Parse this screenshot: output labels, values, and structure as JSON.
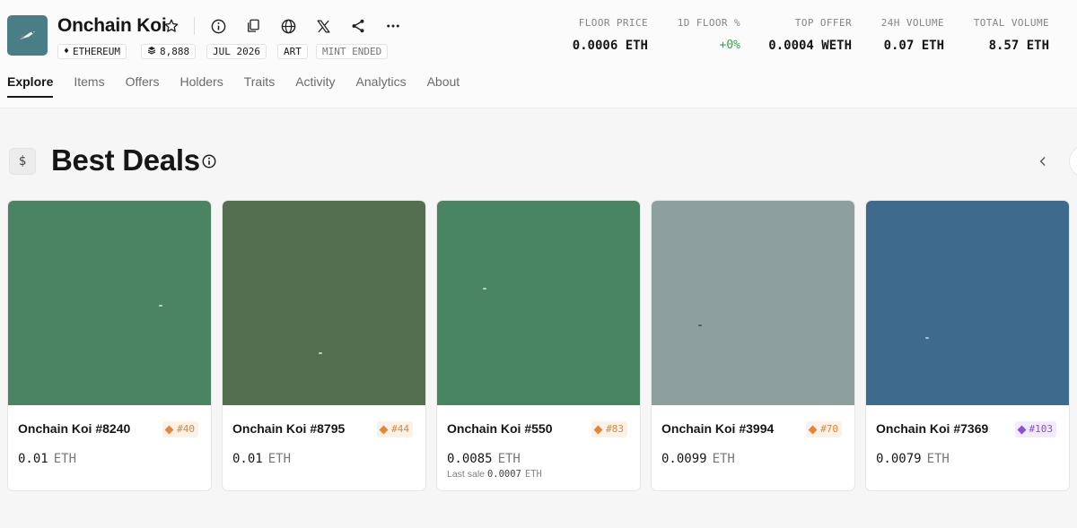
{
  "collection": {
    "name": "Onchain Koi",
    "logo_color": "#4a7e86",
    "chips": {
      "chain": "ETHEREUM",
      "items_count": "8,888",
      "date": "JUL 2026",
      "category": "ART",
      "mint_status": "MINT ENDED"
    },
    "actions": [
      "star-icon",
      "info-icon",
      "copy-icon",
      "globe-icon",
      "x-icon",
      "share-icon",
      "more-icon"
    ]
  },
  "stats": [
    {
      "label": "FLOOR PRICE",
      "value": "0.0006 ETH"
    },
    {
      "label": "1D FLOOR %",
      "value": "+0%"
    },
    {
      "label": "TOP OFFER",
      "value": "0.0004 WETH"
    },
    {
      "label": "24H VOLUME",
      "value": "0.07 ETH"
    },
    {
      "label": "TOTAL VOLUME",
      "value": "8.57 ETH"
    }
  ],
  "tabs": [
    "Explore",
    "Items",
    "Offers",
    "Holders",
    "Traits",
    "Activity",
    "Analytics",
    "About"
  ],
  "active_tab": "Explore",
  "section": {
    "icon_glyph": "$",
    "title": "Best Deals"
  },
  "cards": [
    {
      "name": "Onchain Koi #8240",
      "rank": "#40",
      "rank_color": "orange",
      "price": "0.01",
      "currency": "ETH",
      "image_color": "#4a8463"
    },
    {
      "name": "Onchain Koi #8795",
      "rank": "#44",
      "rank_color": "orange",
      "price": "0.01",
      "currency": "ETH",
      "image_color": "#546f4f"
    },
    {
      "name": "Onchain Koi #550",
      "rank": "#83",
      "rank_color": "orange",
      "price": "0.0085",
      "currency": "ETH",
      "image_color": "#4a8563",
      "last_sale_label": "Last sale",
      "last_sale_value": "0.0007",
      "last_sale_currency": "ETH"
    },
    {
      "name": "Onchain Koi #3994",
      "rank": "#70",
      "rank_color": "orange",
      "price": "0.0099",
      "currency": "ETH",
      "image_color": "#8ea09e"
    },
    {
      "name": "Onchain Koi #7369",
      "rank": "#103",
      "rank_color": "purple",
      "price": "0.0079",
      "currency": "ETH",
      "image_color": "#3e6a8e"
    }
  ]
}
